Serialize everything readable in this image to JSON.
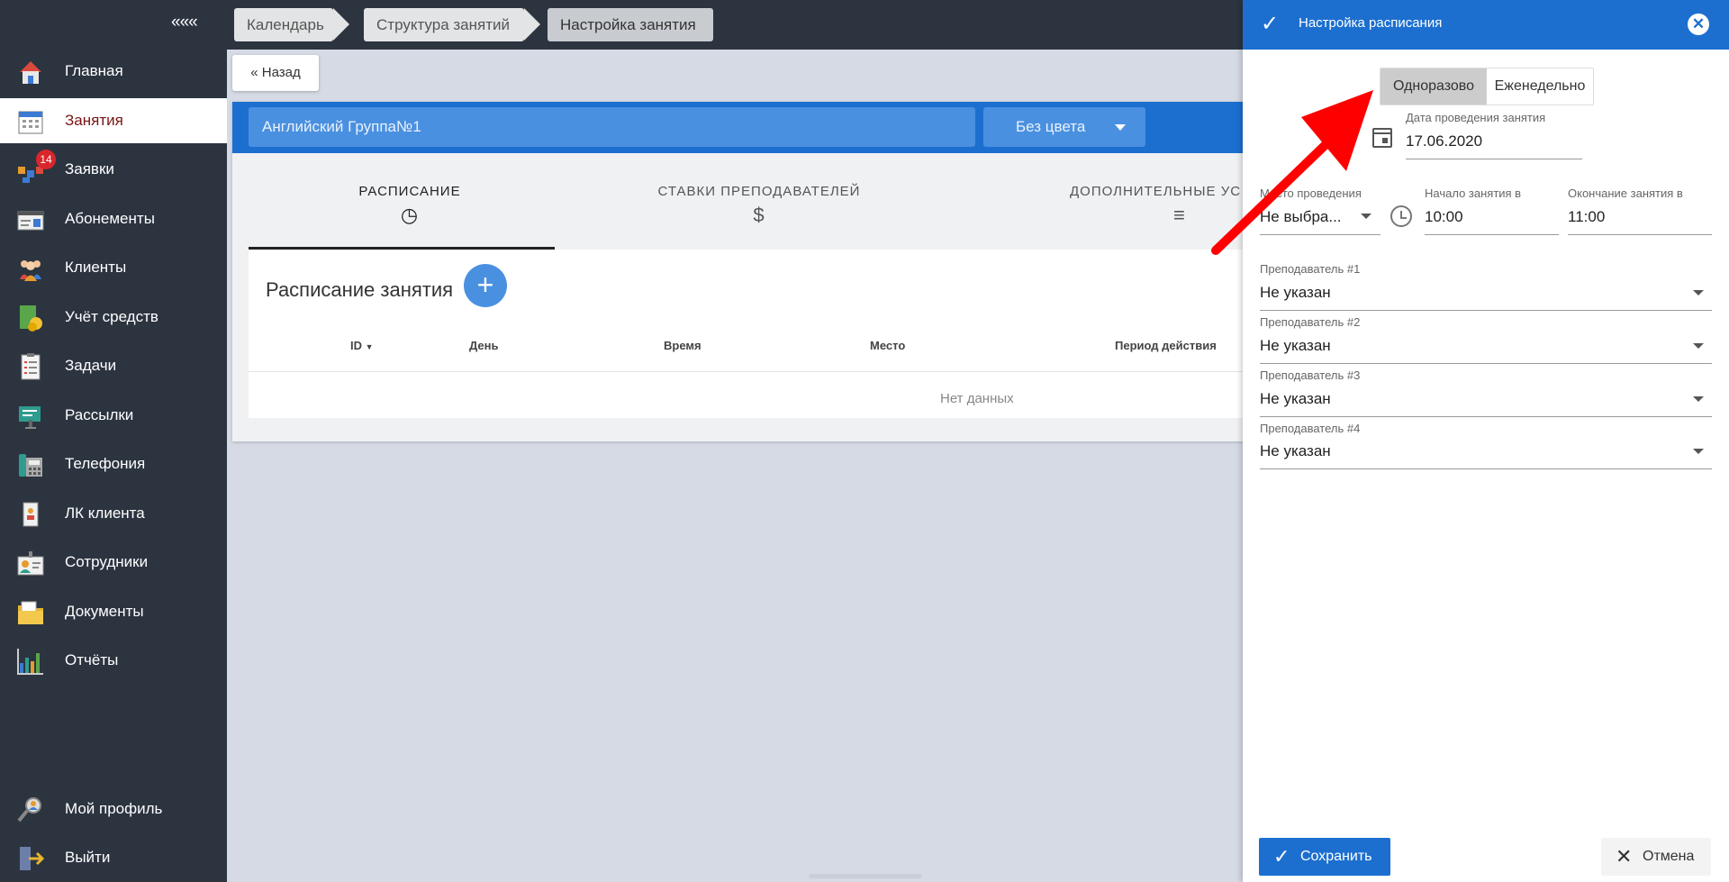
{
  "sidebar": {
    "collapse": "«««",
    "items": [
      {
        "label": "Главная",
        "icon": "home-icon"
      },
      {
        "label": "Занятия",
        "icon": "calendar-icon",
        "active": true
      },
      {
        "label": "Заявки",
        "icon": "requests-icon",
        "badge": "14"
      },
      {
        "label": "Абонементы",
        "icon": "card-icon"
      },
      {
        "label": "Клиенты",
        "icon": "clients-icon"
      },
      {
        "label": "Учёт средств",
        "icon": "money-icon"
      },
      {
        "label": "Задачи",
        "icon": "tasks-icon"
      },
      {
        "label": "Рассылки",
        "icon": "mailing-icon"
      },
      {
        "label": "Телефония",
        "icon": "phone-icon"
      },
      {
        "label": "ЛК клиента",
        "icon": "client-cabinet-icon"
      },
      {
        "label": "Сотрудники",
        "icon": "staff-icon"
      },
      {
        "label": "Документы",
        "icon": "documents-icon"
      },
      {
        "label": "Отчёты",
        "icon": "reports-icon"
      }
    ],
    "bottom": [
      {
        "label": "Мой профиль",
        "icon": "profile-icon"
      },
      {
        "label": "Выйти",
        "icon": "exit-icon"
      }
    ]
  },
  "breadcrumbs": [
    "Календарь",
    "Структура занятий",
    "Настройка занятия"
  ],
  "back": "« Назад",
  "group": {
    "name": "Английский Группа№1",
    "color": "Без цвета"
  },
  "tabs": [
    {
      "label": "РАСПИСАНИЕ",
      "icon": "clock-icon"
    },
    {
      "label": "СТАВКИ ПРЕПОДАВАТЕЛЕЙ",
      "icon": "dollar-icon"
    },
    {
      "label": "ДОПОЛНИТЕЛЬНЫЕ УС…",
      "icon": "list-icon"
    }
  ],
  "schedule": {
    "title": "Расписание занятия",
    "add": "+",
    "columns": [
      "ID",
      "День",
      "Время",
      "Место",
      "Период действия"
    ],
    "empty": "Нет данных"
  },
  "panel": {
    "title": "Настройка расписания",
    "close": "✕",
    "mode": {
      "once": "Одноразово",
      "weekly": "Еженедельно",
      "selected": "once"
    },
    "date": {
      "label": "Дата проведения занятия",
      "value": "17.06.2020"
    },
    "place": {
      "label": "Место проведения",
      "value": "Не выбра..."
    },
    "start": {
      "label": "Начало занятия в",
      "value": "10:00"
    },
    "end": {
      "label": "Окончание занятия в",
      "value": "11:00"
    },
    "teachers": [
      {
        "label": "Преподаватель #1",
        "value": "Не указан"
      },
      {
        "label": "Преподаватель #2",
        "value": "Не указан"
      },
      {
        "label": "Преподаватель #3",
        "value": "Не указан"
      },
      {
        "label": "Преподаватель #4",
        "value": "Не указан"
      }
    ],
    "save": "Сохранить",
    "cancel": "Отмена"
  },
  "colors": {
    "primary": "#1c6fcf",
    "sidebar": "#2c3440",
    "accent": "#7a1414",
    "badge": "#d9262c",
    "annotation": "#ff0000"
  }
}
